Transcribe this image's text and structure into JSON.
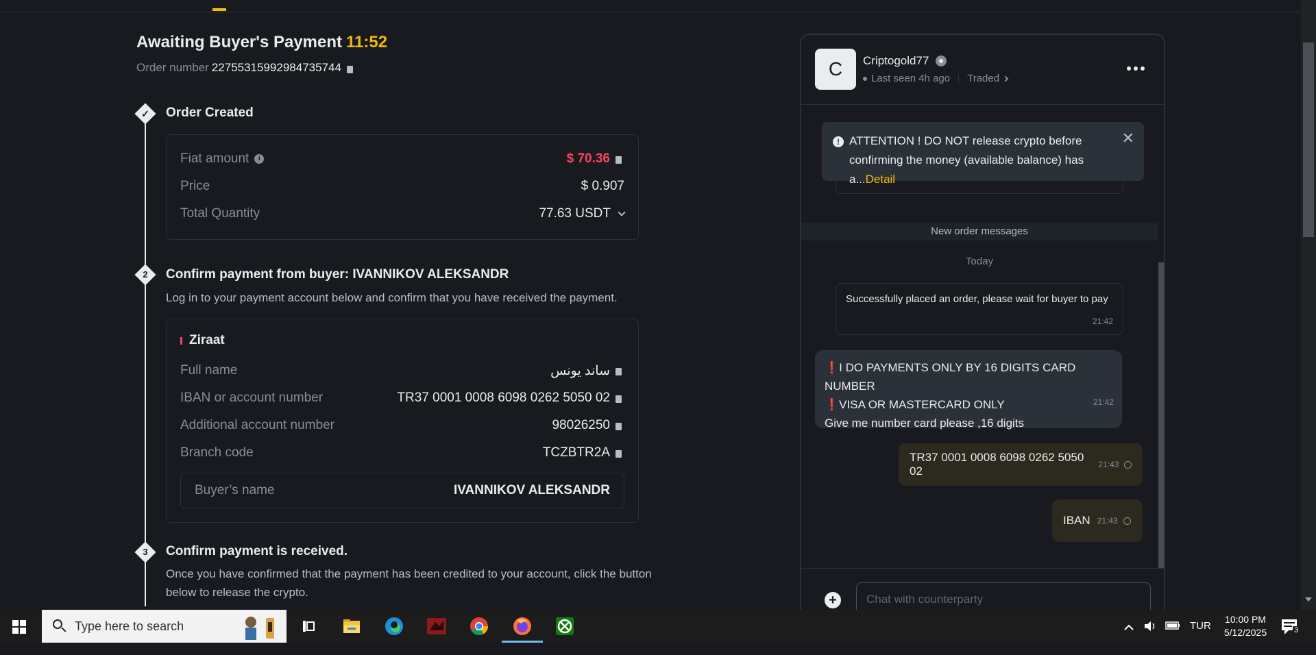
{
  "header": {
    "title": "Awaiting Buyer's Payment",
    "timer": "11:52",
    "order_label": "Order number",
    "order_number": "22755315992984735744"
  },
  "steps": [
    {
      "num": "",
      "title": "Order Created"
    },
    {
      "num": "2",
      "title": "Confirm payment from buyer: IVANNIKOV ALEKSANDR",
      "desc": "Log in to your payment account below and confirm that you have received the payment."
    },
    {
      "num": "3",
      "title": "Confirm payment is received.",
      "desc": "Once you have confirmed that the payment has been credited to your account, click the button below to release the crypto."
    }
  ],
  "order": {
    "fiat_label": "Fiat amount",
    "fiat_value": "$ 70.36",
    "price_label": "Price",
    "price_value": "$ 0.907",
    "qty_label": "Total Quantity",
    "qty_value": "77.63 USDT"
  },
  "payment": {
    "bank": "Ziraat",
    "fullname_label": "Full name",
    "fullname_value": "ساند يونس",
    "iban_label": "IBAN or account number",
    "iban_value": "TR37 0001 0008 6098 0262 5050 02",
    "addl_label": "Additional account number",
    "addl_value": "98026250",
    "branch_label": "Branch code",
    "branch_value": "TCZBTR2A",
    "buyer_label": "Buyer’s name",
    "buyer_value": "IVANNIKOV ALEKSANDR"
  },
  "chat": {
    "avatar_letter": "C",
    "name": "Criptogold77",
    "last_seen": "Last seen 4h ago",
    "traded": "Traded",
    "alert_text": "ATTENTION ! DO NOT release crypto before confirming the money (available balance) has a...",
    "alert_link": "Detail",
    "new_order_messages": "New order messages",
    "today": "Today",
    "system_message": "Successfully placed an order, please wait for buyer to pay",
    "system_time": "21:42",
    "incoming_line1": "I DO PAYMENTS ONLY BY 16 DIGITS CARD NUMBER",
    "incoming_line2": "VISA OR MASTERCARD ONLY",
    "incoming_line3": "Give me number card please ,16 digits",
    "incoming_excl": "❗",
    "incoming_time": "21:42",
    "out1_text": "TR37 0001 0008 6098 0262 5050 02",
    "out1_time": "21:43",
    "out2_text": "IBAN",
    "out2_time": "21:43",
    "input_placeholder": "Chat with counterparty"
  },
  "taskbar": {
    "search_placeholder": "Type here to search",
    "lang": "TUR",
    "time": "10:00 PM",
    "date": "5/12/2025",
    "notif_count": "3"
  },
  "colors": {
    "accent": "#f0b90b",
    "red": "#f6465d",
    "bg": "#181a20"
  }
}
